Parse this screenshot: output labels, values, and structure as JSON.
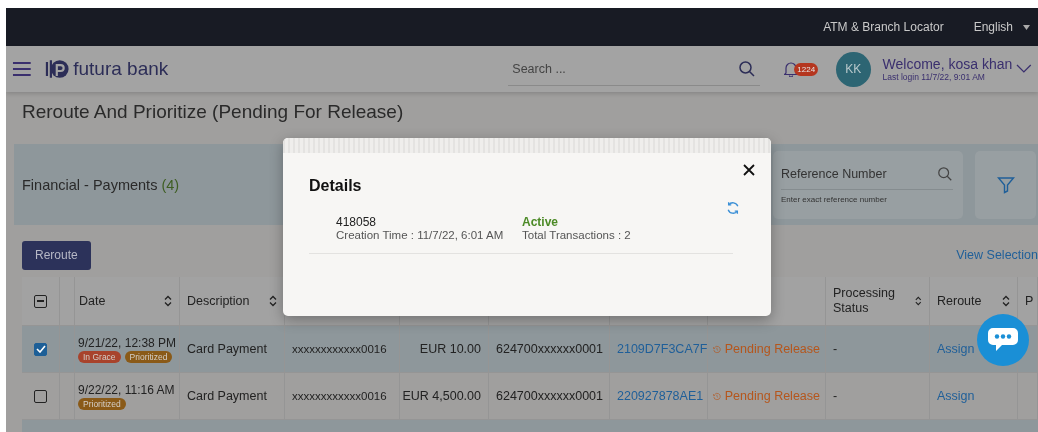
{
  "top_bar": {
    "links": [
      "ATM & Branch Locator",
      "English"
    ]
  },
  "header": {
    "brand": "futura bank",
    "search": {
      "placeholder": "Search ..."
    },
    "notifications": {
      "count": "1224"
    },
    "user": {
      "initials": "KK",
      "welcome": "Welcome, kosa khan",
      "last_login": "Last login 11/7/22, 9:01 AM"
    }
  },
  "page_title": "Reroute And Prioritize (Pending For Release)",
  "summary": {
    "label": "Financial - Payments",
    "count": "(4)"
  },
  "reference_search": {
    "placeholder": "Reference Number",
    "hint": "Enter exact reference number"
  },
  "reroute_button": "Reroute",
  "view_selection": "View Selection",
  "table": {
    "select_all": {
      "indeterminate": true
    },
    "columns": [
      {
        "label": "Date",
        "sortable": true
      },
      {
        "label": "Description",
        "sortable": true
      },
      {
        "label": "Processing Status",
        "sortable": true
      },
      {
        "label": "Reroute",
        "sortable": true
      },
      {
        "label": "P",
        "sortable": false
      }
    ],
    "rows": [
      {
        "selected": true,
        "date": "9/21/22, 12:38 PM",
        "tags": [
          {
            "label": "In Grace",
            "color": "#a8432c"
          },
          {
            "label": "Prioritized",
            "color": "#8a5a18"
          }
        ],
        "description": "Card Payment",
        "account": "xxxxxxxxxxxx0016",
        "amount": "EUR 10.00",
        "card": "624700xxxxxx0001",
        "reference": "2109D7F3CA7F",
        "status": "Pending Release",
        "processing": "-",
        "reroute": "Assign"
      },
      {
        "selected": false,
        "date": "9/22/22, 11:16 AM",
        "tags": [
          {
            "label": "Prioritized",
            "color": "#8a5a18"
          }
        ],
        "description": "Card Payment",
        "account": "xxxxxxxxxxxx0016",
        "amount": "EUR 4,500.00",
        "card": "624700xxxxxx0001",
        "reference": "220927878AE1",
        "status": "Pending Release",
        "processing": "-",
        "reroute": "Assign"
      }
    ]
  },
  "modal": {
    "title": "Details",
    "items": [
      {
        "id": "418058",
        "creation": "Creation Time : 11/7/22, 6:01 AM",
        "status": "Active",
        "total": "Total Transactions : 2"
      }
    ]
  }
}
